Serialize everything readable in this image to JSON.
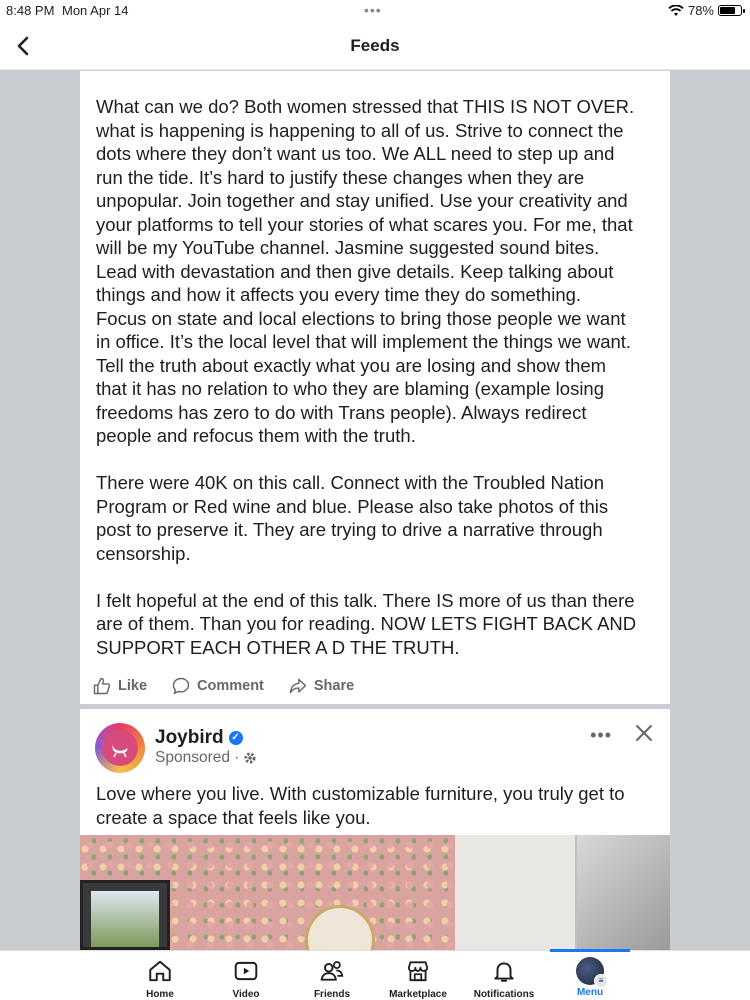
{
  "status_bar": {
    "time": "8:48 PM",
    "date": "Mon Apr 14",
    "battery": "78%",
    "battery_level": 0.78
  },
  "header": {
    "title": "Feeds"
  },
  "post": {
    "text": "What can we do? Both women stressed that THIS IS NOT OVER.\nwhat is happening is happening to all of us. Strive to connect the\ndots where they don’t want us too. We ALL need to step up and\nrun the tide. It’s hard to justify these changes when they are\nunpopular. Join together and stay unified. Use your creativity and\nyour platforms to tell your stories of what scares you. For me, that\nwill be my YouTube channel. Jasmine suggested sound bites.\nLead with devastation and then give details. Keep talking about\nthings and how it affects you every time they do something.\nFocus on state and local elections to bring those people we want\nin office. It’s the local level that will implement the things we want.\nTell the truth about exactly what you are losing and show them\nthat it has no relation to who they are blaming (example losing\nfreedoms has zero to do with Trans people). Always redirect\npeople and refocus them with the truth.\n\nThere were 40K on this call. Connect with the Troubled Nation\nProgram or Red wine and blue. Please also take photos of this\npost to preserve it. They are trying to drive a narrative through\ncensorship.\n\nI felt hopeful at the end of this talk. There IS more of us than there\nare of them. Than you for reading. NOW LETS FIGHT BACK AND\nSUPPORT EACH OTHER A D THE TRUTH.",
    "actions": {
      "like": "Like",
      "comment": "Comment",
      "share": "Share"
    }
  },
  "ad": {
    "page_name": "Joybird",
    "sponsored_label": "Sponsored ·",
    "more_label": "•••",
    "text": "Love where you live. With customizable furniture, you truly get to\ncreate a space that feels like you."
  },
  "tabbar": {
    "tabs": [
      {
        "label": "Home",
        "icon": "home-icon"
      },
      {
        "label": "Video",
        "icon": "video-icon"
      },
      {
        "label": "Friends",
        "icon": "friends-icon"
      },
      {
        "label": "Marketplace",
        "icon": "marketplace-icon"
      },
      {
        "label": "Notifications",
        "icon": "bell-icon"
      },
      {
        "label": "Menu",
        "icon": "profile-avatar"
      }
    ],
    "active": "Menu",
    "accent_color": "#1877f2"
  }
}
